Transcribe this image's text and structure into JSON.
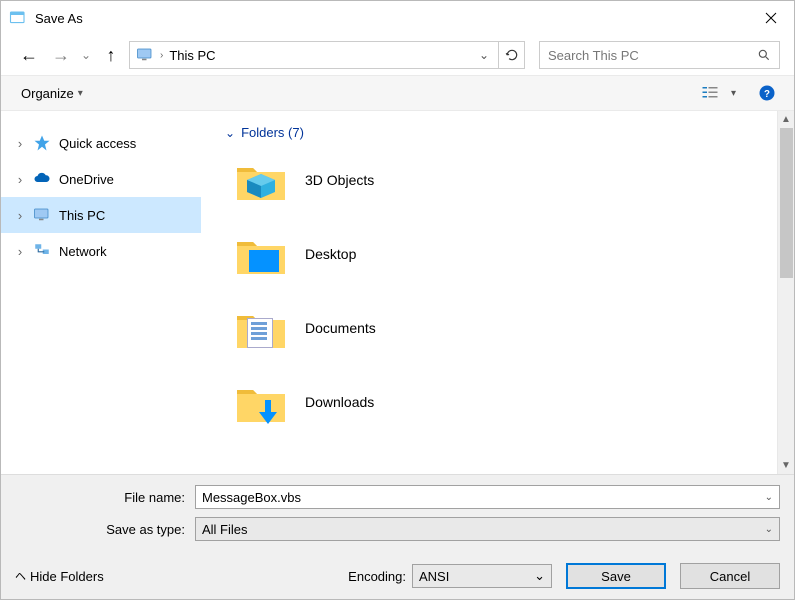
{
  "titlebar": {
    "title": "Save As"
  },
  "address": {
    "location": "This PC"
  },
  "search": {
    "placeholder": "Search This PC"
  },
  "toolbar": {
    "organize": "Organize"
  },
  "tree": {
    "items": [
      {
        "label": "Quick access"
      },
      {
        "label": "OneDrive"
      },
      {
        "label": "This PC"
      },
      {
        "label": "Network"
      }
    ]
  },
  "section": {
    "label": "Folders (7)"
  },
  "folders": [
    {
      "label": "3D Objects"
    },
    {
      "label": "Desktop"
    },
    {
      "label": "Documents"
    },
    {
      "label": "Downloads"
    }
  ],
  "form": {
    "filename_label": "File name:",
    "filename_value": "MessageBox.vbs",
    "saveastype_label": "Save as type:",
    "saveastype_value": "All Files",
    "encoding_label": "Encoding:",
    "encoding_value": "ANSI"
  },
  "footer": {
    "hide_folders": "Hide Folders",
    "save": "Save",
    "cancel": "Cancel"
  }
}
